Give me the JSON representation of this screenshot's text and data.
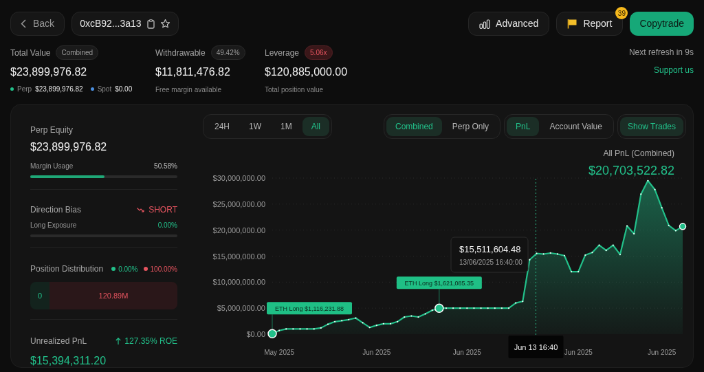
{
  "header": {
    "back_label": "Back",
    "address": "0xcB92...3a13",
    "buttons": [
      {
        "kind": "advanced",
        "label": "Advanced"
      },
      {
        "kind": "report",
        "label": "Report",
        "badge": "39"
      },
      {
        "kind": "copytrade",
        "label": "Copytrade"
      }
    ],
    "refresh": "Next refresh in 9s",
    "support_link": "Support us"
  },
  "summary": [
    {
      "label": "Total Value",
      "tag": "Combined",
      "alert": false,
      "value": "$23,899,976.82",
      "breakdown": [
        {
          "name": "Perp",
          "amount": "$23,899,976.82",
          "color": "#22c08a"
        },
        {
          "name": "Spot",
          "amount": "$0.00",
          "color": "#4a8fe0"
        }
      ]
    },
    {
      "label": "Withdrawable",
      "tag": "49.42%",
      "alert": false,
      "value": "$11,811,476.82",
      "caption": "Free margin available"
    },
    {
      "label": "Leverage",
      "tag": "5.06x",
      "alert": true,
      "value": "$120,885,000.00",
      "caption": "Total position value"
    }
  ],
  "panel": {
    "perp_equity": {
      "label": "Perp Equity",
      "value": "$23,899,976.82",
      "meter_label": "Margin Usage",
      "meter_reading": "50.58%",
      "level": 0.5058
    },
    "direction": {
      "label": "Direction Bias",
      "bias": "SHORT",
      "bearish": true,
      "meter_label": "Long Exposure",
      "meter_reading": "0.00%",
      "level": 0
    },
    "distribution": {
      "label": "Position Distribution",
      "long_share": "0.00%",
      "short_share": "100.00%",
      "long_value": "0",
      "short_value": "120.89M"
    },
    "unrealized": {
      "label": "Unrealized PnL",
      "roe": "127.35% ROE",
      "value": "$15,394,311.20"
    }
  },
  "chart": {
    "ranges": [
      {
        "label": "24H",
        "selected": false
      },
      {
        "label": "1W",
        "selected": false
      },
      {
        "label": "1M",
        "selected": false
      },
      {
        "label": "All",
        "selected": true
      }
    ],
    "modes": [
      {
        "label": "Combined",
        "selected": true
      },
      {
        "label": "Perp Only",
        "selected": false
      }
    ],
    "metrics": [
      {
        "label": "PnL",
        "selected": true
      },
      {
        "label": "Account Value",
        "selected": false
      }
    ],
    "show_trades": {
      "label": "Show Trades",
      "on": true
    },
    "total_label": "All PnL (Combined)",
    "total_value": "$20,703,522.82",
    "chart_data": {
      "type": "area",
      "categories": [
        null,
        "May 2025",
        null,
        null,
        null,
        null,
        null,
        null,
        null,
        null,
        null,
        null,
        null,
        null,
        null,
        "Jun 2025",
        null,
        null,
        null,
        null,
        null,
        null,
        null,
        null,
        null,
        null,
        null,
        null,
        "Jun 2025",
        null,
        null,
        null,
        null,
        null,
        null,
        null,
        null,
        null,
        null,
        null,
        null,
        null,
        null,
        null,
        "Jun 2025",
        null,
        null,
        null,
        null,
        null,
        null,
        null,
        null,
        null,
        null,
        null,
        "Jun 2025",
        null,
        null,
        null
      ],
      "series": [
        {
          "color": "#22c08a",
          "values": [
            100000,
            700000,
            1000000,
            1000000,
            1000000,
            1000000,
            1000000,
            1200000,
            1900000,
            2400000,
            2600000,
            2800000,
            3100000,
            2200000,
            1300000,
            1700000,
            2000000,
            2000000,
            2400000,
            3300000,
            3500000,
            3300000,
            3900000,
            4600000,
            5000000,
            5000000,
            5000000,
            5000000,
            5000000,
            5000000,
            5000000,
            5000000,
            5000000,
            5000000,
            5000000,
            6000000,
            6300000,
            14300000,
            15500000,
            15400000,
            15600000,
            15400000,
            15100000,
            12000000,
            12000000,
            15200000,
            15700000,
            17100000,
            16100000,
            17100000,
            15300000,
            20800000,
            19300000,
            26900000,
            29500000,
            27800000,
            24300000,
            20900000,
            19900000,
            20700000
          ]
        }
      ],
      "ylim": [
        0,
        30000000
      ],
      "grid": true,
      "yticks": [
        {
          "value": 0,
          "label": "$0.00"
        },
        {
          "value": 5000000,
          "label": "$5,000,000.00"
        },
        {
          "value": 10000000,
          "label": "$10,000,000.00"
        },
        {
          "value": 15000000,
          "label": "$15,000,000.00"
        },
        {
          "value": 20000000,
          "label": "$20,000,000.00"
        },
        {
          "value": 25000000,
          "label": "$25,000,000.00"
        },
        {
          "value": 30000000,
          "label": "$30,000,000.00"
        }
      ],
      "annotations": [
        "ETH Long $1,116,231.88",
        "ETH Long $1,621,085.35"
      ]
    },
    "hover": {
      "value": "$15,511,604.48",
      "time": "13/06/2025 16:40:00",
      "axis_label": "Jun 13 16:40"
    }
  }
}
